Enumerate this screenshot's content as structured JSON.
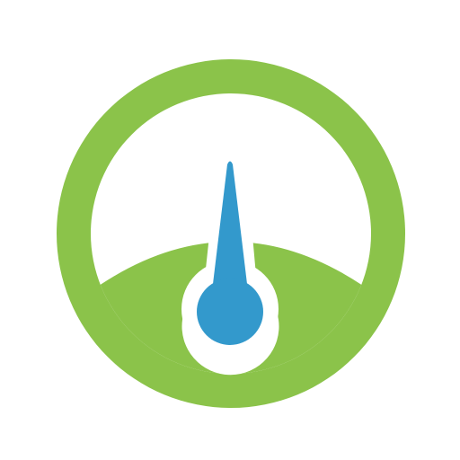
{
  "icon": {
    "name": "speedometer-gauge-icon",
    "colors": {
      "green": "#8BC34A",
      "blue": "#3399CC",
      "white": "#FFFFFF"
    }
  }
}
